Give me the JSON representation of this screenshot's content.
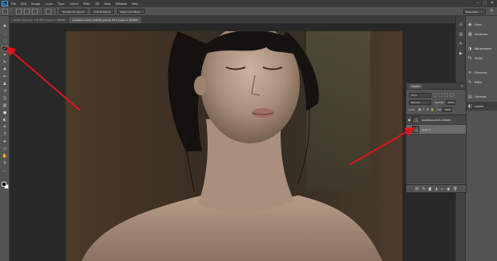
{
  "app": {
    "logo": "Ps"
  },
  "menu": [
    "File",
    "Edit",
    "Image",
    "Layer",
    "Type",
    "Select",
    "Filter",
    "3D",
    "View",
    "Window",
    "Help"
  ],
  "window_controls": [
    "–",
    "□",
    "✕"
  ],
  "options_bar": {
    "sample_label": "Sample All Layers",
    "auto_enhance_label": "Auto-Enhance",
    "select_mask_label": "Select and Mask...",
    "workspace": "Essentials"
  },
  "tabs": [
    {
      "label": "shutter stock pic 3 @ 25% (Layer 0, RGB/8)",
      "active": false
    },
    {
      "label": "anastasia-photo-100000.jpeg @ 25% (Layer 0, RGB/8)",
      "active": true
    }
  ],
  "tools": [
    {
      "name": "move-tool",
      "glyph": "✥"
    },
    {
      "name": "marquee-tool",
      "glyph": "⬚"
    },
    {
      "name": "lasso-tool",
      "glyph": "◌"
    },
    {
      "name": "quick-selection-tool",
      "glyph": "✓"
    },
    {
      "name": "crop-tool",
      "glyph": "⌗"
    },
    {
      "name": "eyedropper-tool",
      "glyph": "✎"
    },
    {
      "name": "healing-brush-tool",
      "glyph": "✚"
    },
    {
      "name": "brush-tool",
      "glyph": "✏"
    },
    {
      "name": "clone-stamp-tool",
      "glyph": "♟"
    },
    {
      "name": "history-brush-tool",
      "glyph": "↺"
    },
    {
      "name": "eraser-tool",
      "glyph": "◫"
    },
    {
      "name": "gradient-tool",
      "glyph": "▥"
    },
    {
      "name": "blur-tool",
      "glyph": "●"
    },
    {
      "name": "dodge-tool",
      "glyph": "◐"
    },
    {
      "name": "pen-tool",
      "glyph": "✒"
    },
    {
      "name": "type-tool",
      "glyph": "T"
    },
    {
      "name": "path-selection-tool",
      "glyph": "➤"
    },
    {
      "name": "shape-tool",
      "glyph": "▭"
    },
    {
      "name": "hand-tool",
      "glyph": "✋"
    },
    {
      "name": "zoom-tool",
      "glyph": "⚲"
    },
    {
      "name": "edit-toolbar-tool",
      "glyph": "…"
    }
  ],
  "dock": {
    "panels": [
      {
        "label": "Color",
        "icon": "◉",
        "active": false
      },
      {
        "label": "Swatches",
        "icon": "▦",
        "active": false
      },
      {
        "label": "Adjustments",
        "icon": "◑",
        "active": false
      },
      {
        "label": "Styles",
        "icon": "fx",
        "active": false
      },
      {
        "label": "Channels",
        "icon": "≋",
        "active": false
      },
      {
        "label": "Paths",
        "icon": "✎",
        "active": false
      },
      {
        "label": "Libraries",
        "icon": "▤",
        "active": false
      },
      {
        "label": "Layers",
        "icon": "◧",
        "active": true
      }
    ]
  },
  "layers_panel": {
    "tab_label": "Layers",
    "kind_label": "Kind",
    "blend_mode": "Normal",
    "opacity_label": "Opacity:",
    "opacity_value": "100%",
    "lock_label": "Lock:",
    "fill_label": "Fill:",
    "fill_value": "100%",
    "layers": [
      {
        "name": "anastasia-photo-100000",
        "selected": false
      },
      {
        "name": "Layer 0",
        "selected": true
      }
    ],
    "footer_icons": [
      "⛓",
      "fx",
      "◙",
      "◑",
      "▭",
      "▣",
      "🗑"
    ]
  },
  "colors": {
    "arrow": "#e0141c",
    "panel_bg": "#535353",
    "app_bg": "#282828"
  }
}
